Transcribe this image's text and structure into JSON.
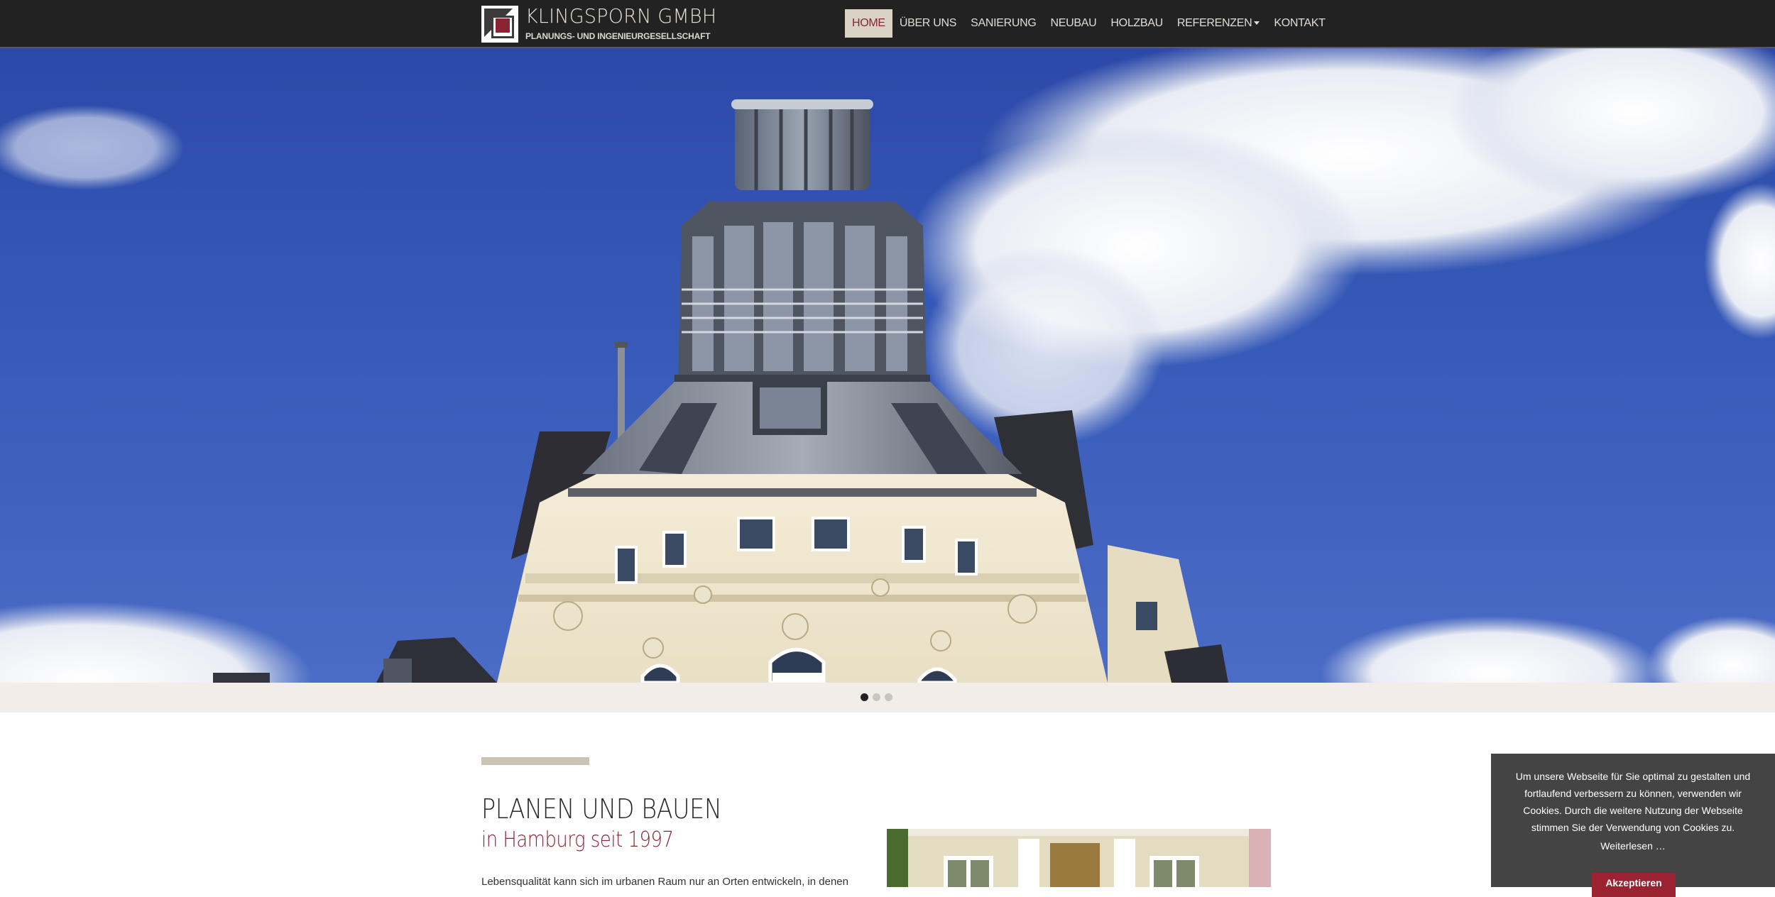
{
  "brand": {
    "name": "KLINGSPORN GMBH",
    "subtitle": "PLANUNGS- UND INGENIEURGESELLSCHAFT",
    "logo_icon": "logo-square-icon"
  },
  "nav": {
    "items": [
      {
        "label": "HOME",
        "active": true
      },
      {
        "label": "ÜBER UNS"
      },
      {
        "label": "SANIERUNG"
      },
      {
        "label": "NEUBAU"
      },
      {
        "label": "HOLZBAU"
      },
      {
        "label": "REFERENZEN",
        "dropdown": true
      },
      {
        "label": "KONTAKT"
      }
    ]
  },
  "slider": {
    "slide_count": 3,
    "active_index": 0
  },
  "intro": {
    "title": "PLANEN UND BAUEN",
    "subtitle": "in Hamburg seit 1997",
    "body": "Lebensqualität kann sich im urbanen Raum nur an Orten entwickeln, in denen"
  },
  "cookie": {
    "text": "Um unsere Webseite für Sie optimal zu gestalten und fortlaufend verbessern zu können, verwenden wir Cookies. Durch die weitere Nutzung der Webseite stimmen Sie der Verwendung von Cookies zu.",
    "more_label": "Weiterlesen …",
    "accept_label": "Akzeptieren"
  },
  "colors": {
    "header_bg": "#222222",
    "accent_red": "#8a2432",
    "nav_active_bg": "#d9d2c5",
    "slider_bar_bg": "#f2ede8",
    "cookie_bg": "#444444"
  }
}
